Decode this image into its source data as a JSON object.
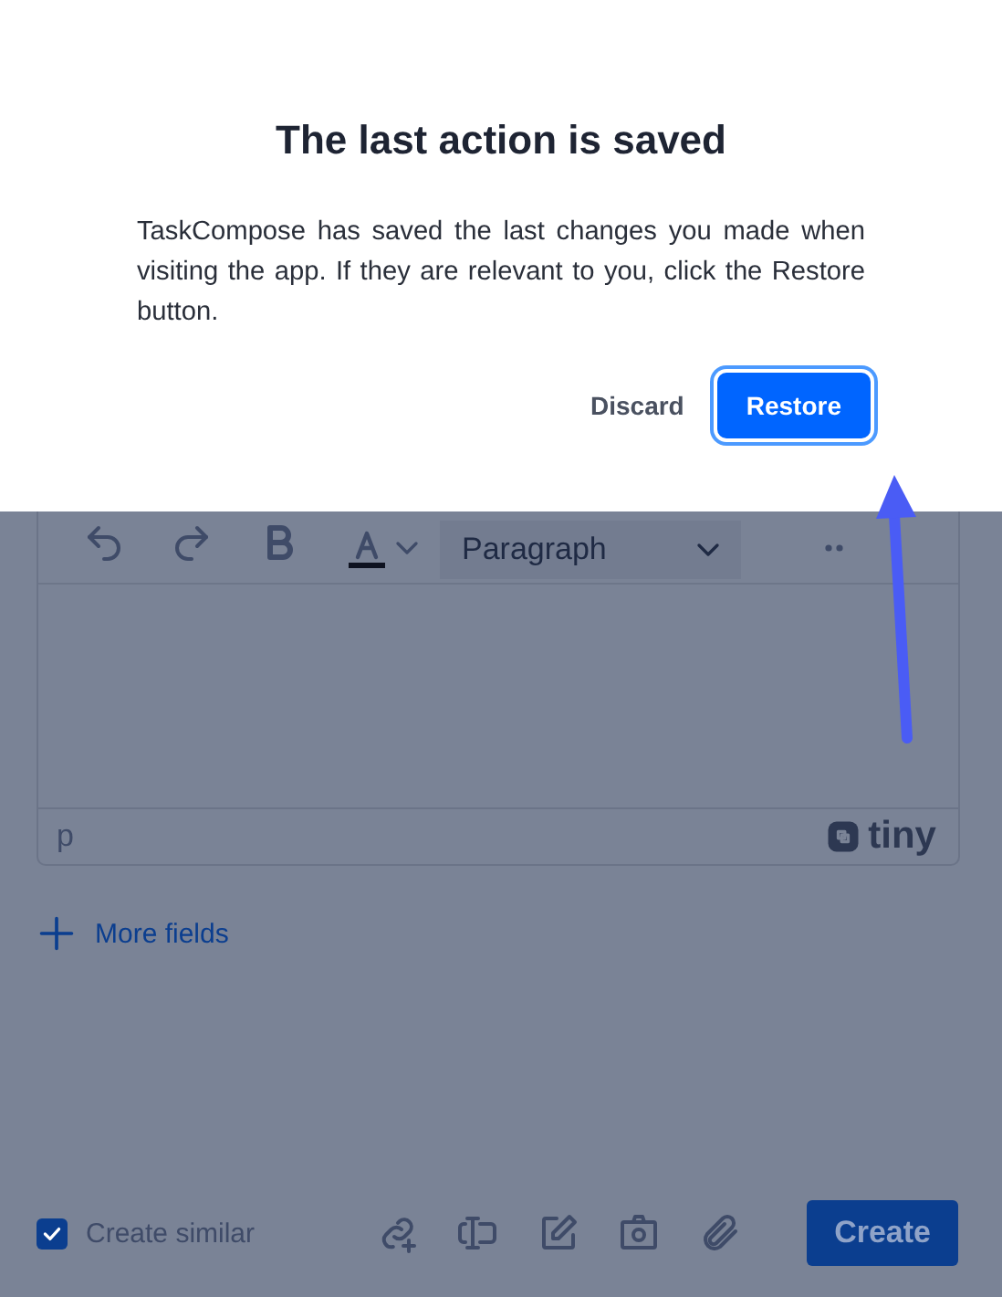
{
  "dialog": {
    "title": "The last action is saved",
    "message": "TaskCompose has saved the last changes you made when visiting the app. If they are relevant to you, click the Restore button.",
    "buttons": [
      {
        "label": "Discard",
        "kind": "text"
      },
      {
        "label": "Restore",
        "kind": "primary"
      }
    ]
  },
  "editor": {
    "block_format": "Paragraph",
    "status_path": "p",
    "brand": "tiny"
  },
  "more_fields": "More fields",
  "footer": {
    "create_similar": {
      "label": "Create similar",
      "checked": true
    },
    "create_button": "Create"
  }
}
